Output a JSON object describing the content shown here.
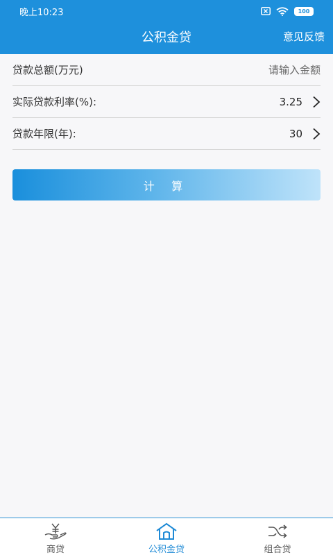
{
  "status_bar": {
    "time": "晚上10:23",
    "battery": "100"
  },
  "header": {
    "title": "公积金贷",
    "feedback_label": "意见反馈"
  },
  "form": {
    "amount_label": "贷款总额(万元)",
    "amount_placeholder": "请输入金额",
    "rate_label": "实际贷款利率(%):",
    "rate_value": "3.25",
    "years_label": "贷款年限(年):",
    "years_value": "30"
  },
  "calculate_label": "计 算",
  "bottom_nav": {
    "items": [
      {
        "label": "商贷",
        "icon": "yuan-hand-icon",
        "active": false
      },
      {
        "label": "公积金贷",
        "icon": "house-icon",
        "active": true
      },
      {
        "label": "组合贷",
        "icon": "shuffle-icon",
        "active": false
      }
    ]
  },
  "colors": {
    "primary": "#1e90dc",
    "active_nav": "#1e8ad6",
    "background": "#f7f7f9"
  }
}
